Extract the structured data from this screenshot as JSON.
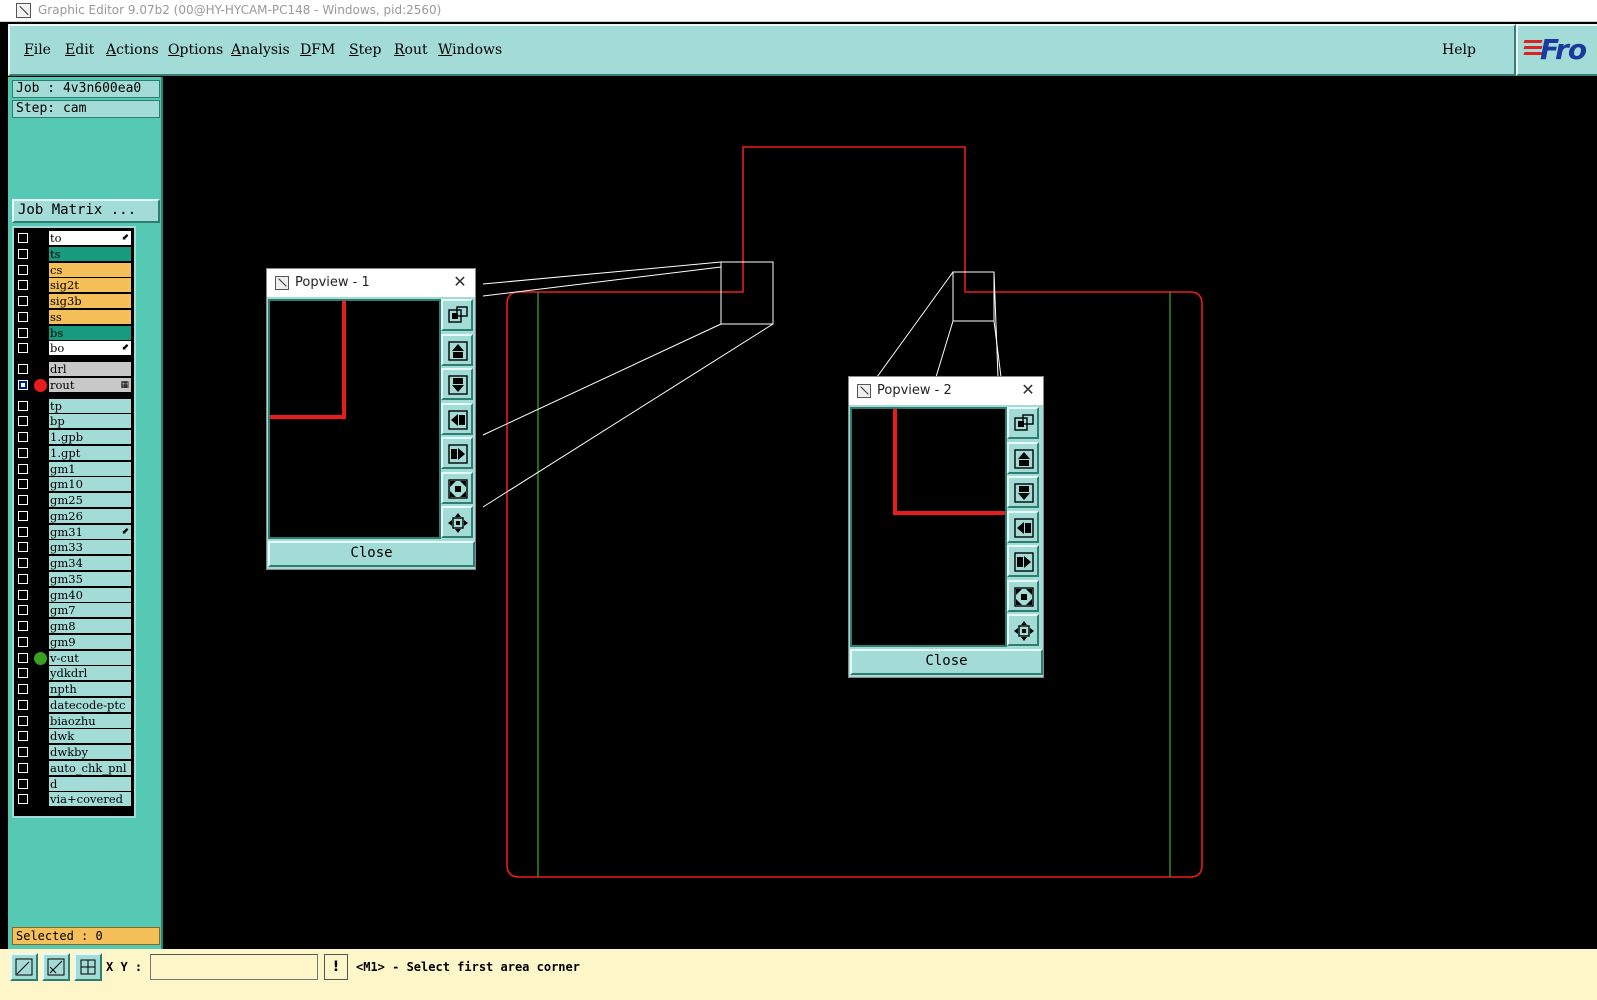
{
  "window": {
    "title": "Graphic Editor 9.07b2 (00@HY-HYCAM-PC148 - Windows, pid:2560)"
  },
  "menu": {
    "items": [
      {
        "label": "File",
        "accent": "F",
        "rest": "ile"
      },
      {
        "label": "Edit",
        "accent": "E",
        "rest": "dit"
      },
      {
        "label": "Actions",
        "accent": "A",
        "rest": "ctions"
      },
      {
        "label": "Options",
        "accent": "O",
        "rest": "ptions"
      },
      {
        "label": "Analysis",
        "accent": "A",
        "rest": "nalysis"
      },
      {
        "label": "DFM",
        "accent": "D",
        "rest": "FM"
      },
      {
        "label": "Step",
        "accent": "S",
        "rest": "tep"
      },
      {
        "label": "Rout",
        "accent": "R",
        "rest": "out"
      },
      {
        "label": "Windows",
        "accent": "W",
        "rest": "indows"
      }
    ],
    "help": "Help",
    "logo": "Fro"
  },
  "job": {
    "job_label": "Job : 4v3n600ea0",
    "step_label": "Step: cam",
    "matrix_button": "Job Matrix ..."
  },
  "layers": [
    {
      "name": "to",
      "color": "#ffffff",
      "mark": "⬋"
    },
    {
      "name": "ts",
      "color": "#179a7e"
    },
    {
      "name": "cs",
      "color": "#f5c05a"
    },
    {
      "name": "sig2t",
      "color": "#f5c05a"
    },
    {
      "name": "sig3b",
      "color": "#f5c05a"
    },
    {
      "name": "ss",
      "color": "#f5c05a"
    },
    {
      "name": "bs",
      "color": "#179a7e"
    },
    {
      "name": "bo",
      "color": "#ffffff",
      "mark": "⬋"
    },
    {
      "name": "drl",
      "color": "#c8c8c8"
    },
    {
      "name": "rout",
      "color": "#c8c8c8",
      "active": true,
      "dot": "#e81c1c",
      "mark": "▦"
    },
    {
      "name": "tp",
      "color": "#a3dcd7"
    },
    {
      "name": "bp",
      "color": "#a3dcd7"
    },
    {
      "name": "1.gpb",
      "color": "#a3dcd7"
    },
    {
      "name": "1.gpt",
      "color": "#a3dcd7"
    },
    {
      "name": "gm1",
      "color": "#a3dcd7"
    },
    {
      "name": "gm10",
      "color": "#a3dcd7"
    },
    {
      "name": "gm25",
      "color": "#a3dcd7"
    },
    {
      "name": "gm26",
      "color": "#a3dcd7"
    },
    {
      "name": "gm31",
      "color": "#a3dcd7",
      "mark": "⬋"
    },
    {
      "name": "gm33",
      "color": "#a3dcd7"
    },
    {
      "name": "gm34",
      "color": "#a3dcd7"
    },
    {
      "name": "gm35",
      "color": "#a3dcd7"
    },
    {
      "name": "gm40",
      "color": "#a3dcd7"
    },
    {
      "name": "gm7",
      "color": "#a3dcd7"
    },
    {
      "name": "gm8",
      "color": "#a3dcd7"
    },
    {
      "name": "gm9",
      "color": "#a3dcd7"
    },
    {
      "name": "v-cut",
      "color": "#a3dcd7",
      "dot": "#3aa020"
    },
    {
      "name": "ydkdrl",
      "color": "#a3dcd7"
    },
    {
      "name": "npth",
      "color": "#a3dcd7"
    },
    {
      "name": "datecode-ptc",
      "color": "#a3dcd7"
    },
    {
      "name": "biaozhu",
      "color": "#a3dcd7"
    },
    {
      "name": "dwk",
      "color": "#a3dcd7"
    },
    {
      "name": "dwkby",
      "color": "#a3dcd7"
    },
    {
      "name": "auto_chk_pnl",
      "color": "#a3dcd7"
    },
    {
      "name": "d",
      "color": "#a3dcd7"
    },
    {
      "name": "via+covered",
      "color": "#a3dcd7"
    }
  ],
  "selected": "Selected : 0",
  "popviews": [
    {
      "title": "Popview - 1",
      "close_label": "Close"
    },
    {
      "title": "Popview - 2",
      "close_label": "Close"
    }
  ],
  "tools": {
    "icons": [
      "zoom-window-icon",
      "pan-up-icon",
      "pan-down-icon",
      "pan-left-icon",
      "pan-right-icon",
      "zoom-out-icon",
      "zoom-home-icon"
    ]
  },
  "status": {
    "xy_label": "X Y :",
    "xy_value": "",
    "warn": "!",
    "message": "<M1> - Select first area corner"
  },
  "colors": {
    "panel": "#a3dcd7",
    "panel_dark": "#56c9b5",
    "outline": "#e81c1c",
    "vcut": "#3aa020",
    "status_bg": "#fcf6c8"
  }
}
